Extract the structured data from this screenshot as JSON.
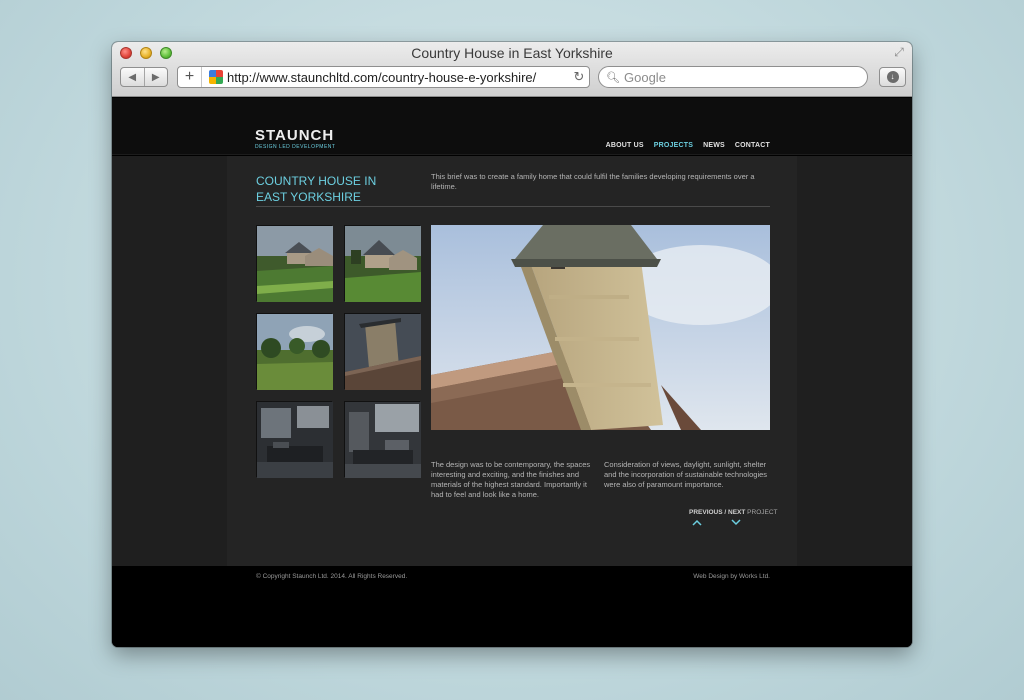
{
  "browser": {
    "window_title": "Country House in East Yorkshire",
    "url": "http://www.staunchltd.com/country-house-e-yorkshire/",
    "search_placeholder": "Google",
    "back_glyph": "◀",
    "forward_glyph": "▶",
    "add_glyph": "+",
    "reload_glyph": "↻",
    "fullscreen_glyph": "⤢",
    "download_glyph": "↓",
    "search_glyph": "🔍︎"
  },
  "site": {
    "logo_name": "STAUNCH",
    "logo_tagline": "DESIGN LED DEVELOPMENT",
    "accent_color": "#6ccfe0",
    "nav": [
      {
        "label": "ABOUT US",
        "active": false
      },
      {
        "label": "PROJECTS",
        "active": true
      },
      {
        "label": "NEWS",
        "active": false
      },
      {
        "label": "CONTACT",
        "active": false
      }
    ]
  },
  "project": {
    "title": "COUNTRY HOUSE IN EAST YORKSHIRE",
    "intro": "This brief was to create a family home that could fulfil the families developing requirements over a lifetime.",
    "body_left": "The design was to be contemporary, the spaces interesting and exciting, and the finishes and materials of the highest standard. Importantly it had to feel and look like a home.",
    "body_right": "Consideration of views, daylight, sunlight, shelter and the incorporation of sustainable technologies were also of paramount importance.",
    "pager_previous": "PREVIOUS",
    "pager_separator": " / ",
    "pager_next": "NEXT",
    "pager_suffix": " PROJECT"
  },
  "footer": {
    "copyright": "© Copyright Staunch Ltd. 2014. All Rights Reserved.",
    "credit": "Web Design by Works Ltd."
  }
}
